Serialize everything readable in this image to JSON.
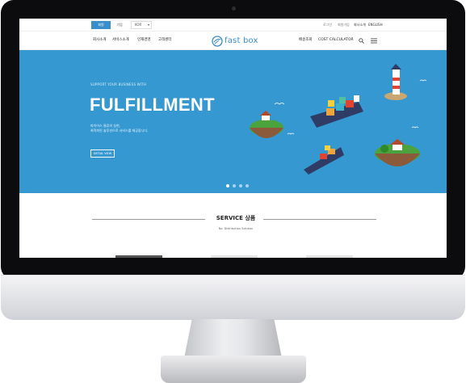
{
  "utility_bar": {
    "tabs": [
      "회원",
      "기업"
    ],
    "select_value": "KOR",
    "links": [
      "로그인",
      "회원가입",
      "회사소개",
      "ENGLISH"
    ]
  },
  "nav": {
    "left_items": [
      "회사소개",
      "서비스소개",
      "인재경영",
      "고객센터"
    ],
    "logo_text": "fast box",
    "right_items": [
      "배송조회",
      "COST CALCULATOR"
    ],
    "icons": [
      "search-icon",
      "menu-icon"
    ]
  },
  "hero": {
    "kicker": "SUPPORT YOUR BUSINESS WITH",
    "title": "FULFILLMENT",
    "desc_line1": "파이어스 물류의 실현,",
    "desc_line2": "최적화된 솔루션으로 서비스를 제공합니다.",
    "button": "DETAIL VIEW",
    "slides": 4,
    "active_slide": 1,
    "background": "#3598d1"
  },
  "service": {
    "title": "SERVICE 상품",
    "subtitle": "No. Distribution Solution"
  },
  "colors": {
    "accent": "#3a8ec9",
    "hero_bg": "#3598d1"
  }
}
